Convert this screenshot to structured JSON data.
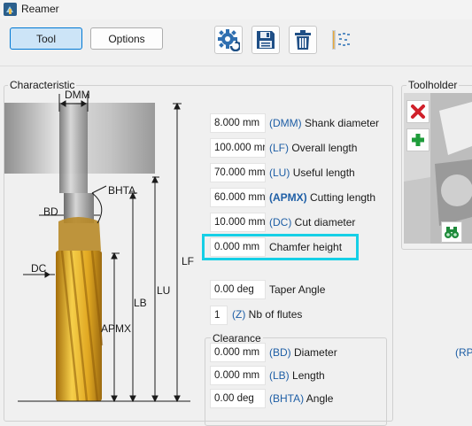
{
  "window": {
    "title": "Reamer",
    "icon": "reamer-app-icon"
  },
  "toolbar": {
    "tab_tool": "Tool",
    "tab_options": "Options",
    "icons": [
      "gear-refresh-icon",
      "save-icon",
      "trash-icon",
      "tool-library-icon"
    ]
  },
  "characteristic": {
    "label": "Characteristic",
    "fields": [
      {
        "value": "8.000 mm",
        "code": "(DMM)",
        "name": "Shank diameter"
      },
      {
        "value": "100.000 mr",
        "code": "(LF)",
        "name": "Overall length"
      },
      {
        "value": "70.000 mm",
        "code": "(LU)",
        "name": "Useful length"
      },
      {
        "value": "60.000 mm",
        "code": "(APMX)",
        "name": "Cutting length"
      },
      {
        "value": "10.000 mm",
        "code": "(DC)",
        "name": "Cut diameter"
      },
      {
        "value": "0.000 mm",
        "code": "",
        "name": "Chamfer height"
      },
      {
        "value": "0.00 deg",
        "code": "",
        "name": "Taper Angle"
      },
      {
        "value": "1",
        "code": "(Z)",
        "name": "Nb of flutes"
      }
    ]
  },
  "clearance": {
    "label": "Clearance",
    "fields": [
      {
        "value": "0.000 mm",
        "code": "(BD)",
        "name": "Diameter"
      },
      {
        "value": "0.000 mm",
        "code": "(LB)",
        "name": "Length"
      },
      {
        "value": "0.00 deg",
        "code": "(BHTA)",
        "name": "Angle"
      }
    ]
  },
  "diagram": {
    "labels": {
      "dmm": "DMM",
      "bhta": "BHTA",
      "bd": "BD",
      "dc": "DC",
      "apmx": "APMX",
      "lb": "LB",
      "lu": "LU",
      "lf": "LF"
    }
  },
  "toolholder": {
    "label": "Toolholder",
    "icons": [
      "delete-x-icon",
      "add-plus-icon",
      "binoculars-icon"
    ]
  },
  "right_cut_text": "(RPI",
  "colors": {
    "highlight": "#16cfe6",
    "code": "#1f5fa6",
    "active_tab": "#cce4f7",
    "gold": "#d9a520"
  }
}
